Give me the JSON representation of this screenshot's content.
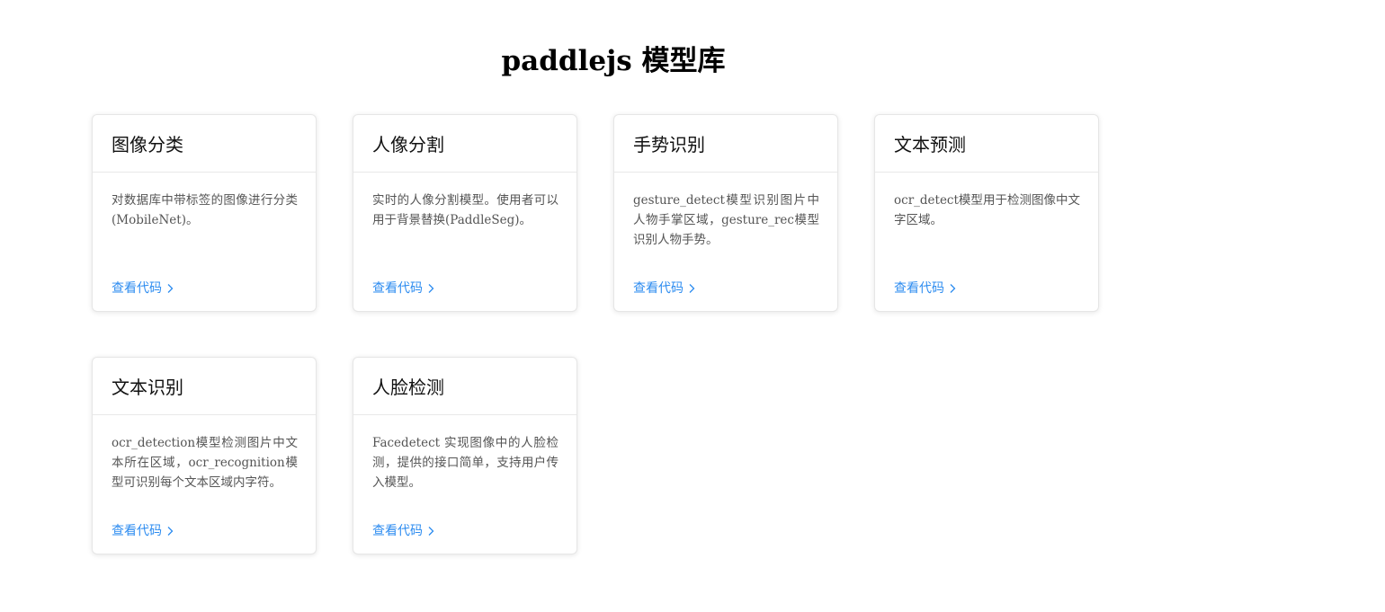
{
  "page": {
    "title": "paddlejs 模型库"
  },
  "cards": [
    {
      "title": "图像分类",
      "description": "对数据库中带标签的图像进行分类 (MobileNet)。",
      "link_label": "查看代码"
    },
    {
      "title": "人像分割",
      "description": "实时的人像分割模型。使用者可以用于背景替换(PaddleSeg)。",
      "link_label": "查看代码"
    },
    {
      "title": "手势识别",
      "description": "gesture_detect模型识别图片中人物手掌区域，gesture_rec模型识别人物手势。",
      "link_label": "查看代码"
    },
    {
      "title": "文本预测",
      "description": "ocr_detect模型用于检测图像中文字区域。",
      "link_label": "查看代码"
    },
    {
      "title": "文本识别",
      "description": "ocr_detection模型检测图片中文本所在区域，ocr_recognition模型可识别每个文本区域内字符。",
      "link_label": "查看代码"
    },
    {
      "title": "人脸检测",
      "description": "Facedetect 实现图像中的人脸检测，提供的接口简单，支持用户传入模型。",
      "link_label": "查看代码"
    }
  ],
  "icons": {
    "link": "chevron-right-icon"
  },
  "colors": {
    "link": "#2d8cf0",
    "card_border": "#e6e6e6",
    "description_text": "#555555"
  }
}
